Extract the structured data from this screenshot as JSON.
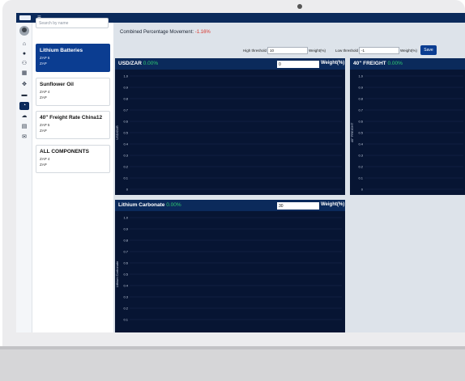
{
  "app": {
    "menu_icon": "hamburger-icon",
    "logo": "brand-logo"
  },
  "iconbar": {
    "items": [
      "home-icon",
      "user-icon",
      "users-icon",
      "boxes-icon",
      "handshake-icon",
      "archive-icon",
      "dashboard-icon",
      "chat-icon",
      "calendar-icon",
      "envelope-icon"
    ],
    "active": "dashboard-icon"
  },
  "sidebar": {
    "search_placeholder": "Search by name",
    "components": [
      {
        "name": "Lithium Batteries",
        "line1": "ZAP 6",
        "line2": "ZAP",
        "selected": true
      },
      {
        "name": "Sunflower Oil",
        "line1": "ZAP 4",
        "line2": "ZAP",
        "selected": false
      },
      {
        "name": "40\" Freight Rate China12",
        "line1": "ZAP 5",
        "line2": "ZAP",
        "selected": false
      },
      {
        "name": "ALL COMPONENTS",
        "line1": "ZAP 4",
        "line2": "ZAP",
        "selected": false
      }
    ]
  },
  "header": {
    "combined_label": "Combined Percentage Movement:",
    "combined_value": "-1.16%",
    "high_label": "High threshold",
    "high_value": "10",
    "high_unit": "Weight(%)",
    "low_label": "Low threshold",
    "low_value": "-1",
    "low_unit": "Weight(%)",
    "save_label": "Save"
  },
  "panels": [
    {
      "title": "USD/ZAR",
      "pct": "0.00%",
      "weight": "0",
      "weight_label": "Weight(%)",
      "ytitle": "USD/ZAR"
    },
    {
      "title": "40\" FREIGHT",
      "pct": "0.00%",
      "weight": "",
      "weight_label": "",
      "ytitle": "40\" FREIGHT"
    },
    {
      "title": "Lithium Carbonate",
      "pct": "0.00%",
      "weight": "30",
      "weight_label": "Weight(%)",
      "ytitle": "Lithium Carbonate"
    }
  ],
  "chart_data": [
    {
      "type": "line",
      "title": "USD/ZAR",
      "ylabel": "USD/ZAR",
      "yticks": [
        "1.0",
        "0.9",
        "0.8",
        "0.7",
        "0.6",
        "0.5",
        "0.4",
        "0.3",
        "0.2",
        "0.1",
        "0"
      ],
      "ylim": [
        0,
        1
      ],
      "series": []
    },
    {
      "type": "line",
      "title": "40\" FREIGHT",
      "ylabel": "40\" FREIGHT",
      "yticks": [
        "1.0",
        "0.9",
        "0.8",
        "0.7",
        "0.6",
        "0.5",
        "0.4",
        "0.3",
        "0.2",
        "0.1",
        "0"
      ],
      "ylim": [
        0,
        1
      ],
      "series": []
    },
    {
      "type": "line",
      "title": "Lithium Carbonate",
      "ylabel": "Lithium Carbonate",
      "yticks": [
        "1.0",
        "0.9",
        "0.8",
        "0.7",
        "0.6",
        "0.5",
        "0.4",
        "0.3",
        "0.2",
        "0.1"
      ],
      "ylim": [
        0,
        1
      ],
      "series": []
    }
  ]
}
